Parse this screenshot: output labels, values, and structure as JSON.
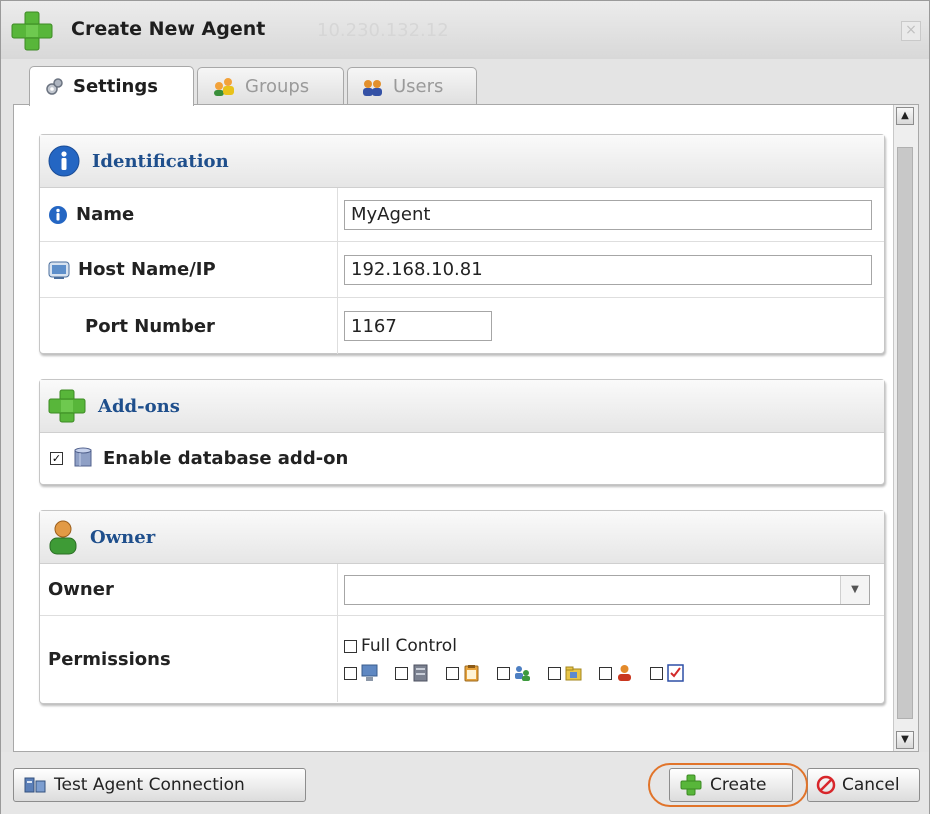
{
  "window": {
    "title": "Create New Agent",
    "title_ghost": "10.230.132.12"
  },
  "tabs": [
    {
      "label": "Settings",
      "active": true,
      "icon": "gears-icon"
    },
    {
      "label": "Groups",
      "active": false,
      "icon": "groups-icon"
    },
    {
      "label": "Users",
      "active": false,
      "icon": "users-icon"
    }
  ],
  "identification": {
    "heading": "Identification",
    "name_label": "Name",
    "name_value": "MyAgent",
    "host_label": "Host Name/IP",
    "host_value": "192.168.10.81",
    "port_label": "Port Number",
    "port_value": "1167"
  },
  "addons": {
    "heading": "Add-ons",
    "database_label": "Enable database add-on",
    "database_checked": true
  },
  "owner": {
    "heading": "Owner",
    "owner_label": "Owner",
    "owner_value": "",
    "permissions_label": "Permissions",
    "full_control_label": "Full Control",
    "permission_icons": [
      "computer-icon",
      "server-icon",
      "clipboard-icon",
      "network-users-icon",
      "folder-icon",
      "user-icon",
      "checklist-icon"
    ]
  },
  "footer": {
    "test_label": "Test Agent Connection",
    "create_label": "Create",
    "cancel_label": "Cancel"
  },
  "colors": {
    "accent_blue": "#1f4f8c",
    "plus_green": "#58b63a",
    "highlight_orange": "#e1742a",
    "cancel_red": "#d8262b"
  }
}
